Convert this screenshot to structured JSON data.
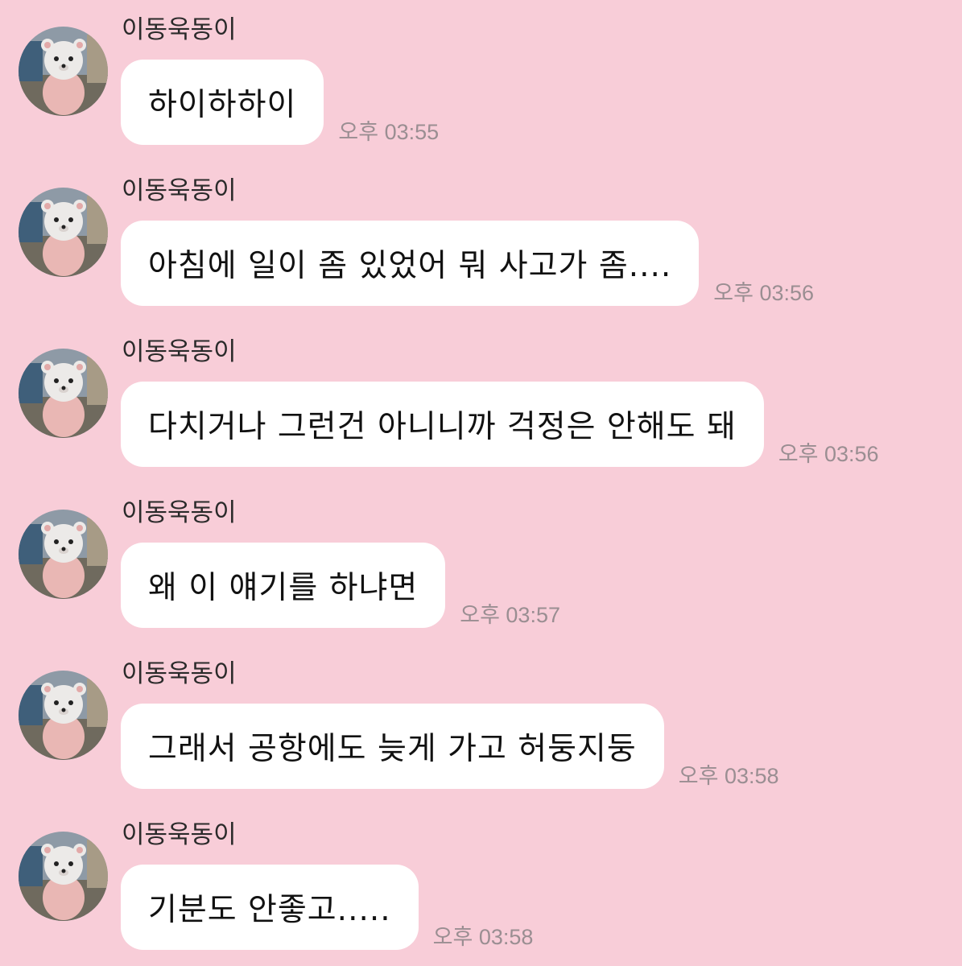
{
  "messages": [
    {
      "sender": "이동욱동이",
      "text": "하이하하이",
      "time": "오후 03:55"
    },
    {
      "sender": "이동욱동이",
      "text": "아침에 일이 좀 있었어 뭐 사고가 좀....",
      "time": "오후 03:56"
    },
    {
      "sender": "이동욱동이",
      "text": "다치거나 그런건 아니니까 걱정은 안해도 돼",
      "time": "오후 03:56"
    },
    {
      "sender": "이동욱동이",
      "text": "왜 이 얘기를 하냐면",
      "time": "오후 03:57"
    },
    {
      "sender": "이동욱동이",
      "text": "그래서 공항에도 늦게 가고 허둥지둥",
      "time": "오후 03:58"
    },
    {
      "sender": "이동욱동이",
      "text": "기분도 안좋고.....",
      "time": "오후 03:58"
    }
  ],
  "avatar_icon": "bear-plush-avatar-icon",
  "colors": {
    "background": "#f8cdd8",
    "bubble": "#ffffff",
    "timestamp": "#9a8e92"
  }
}
